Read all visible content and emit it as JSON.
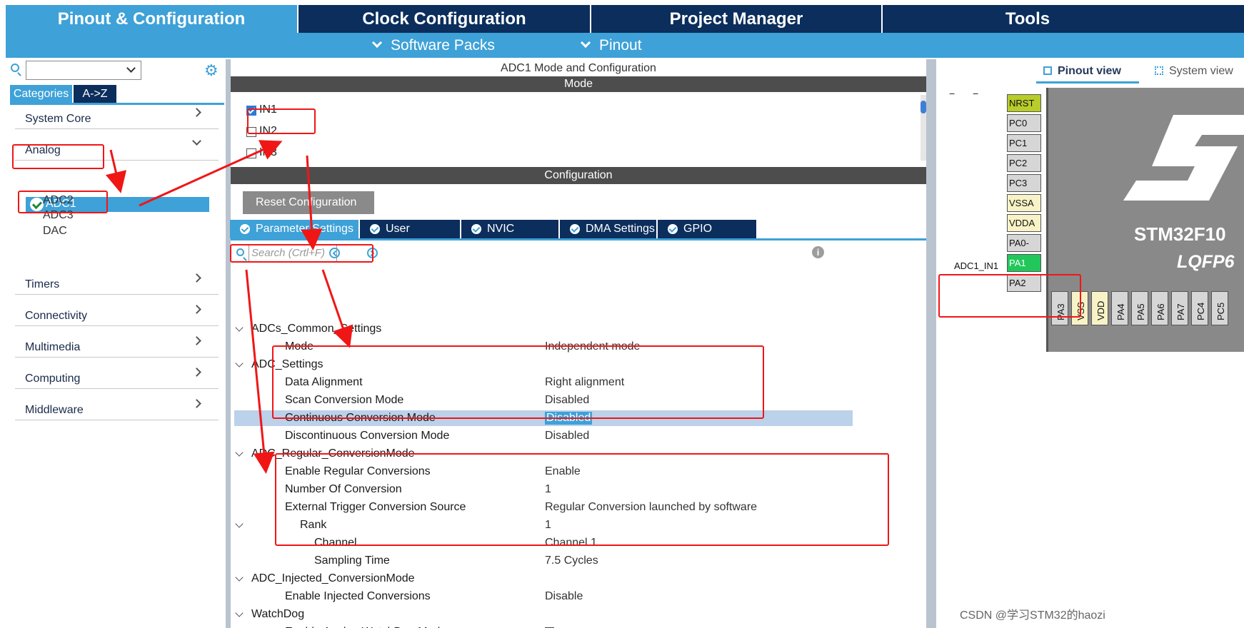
{
  "top_tabs": [
    "Pinout & Configuration",
    "Clock Configuration",
    "Project Manager",
    "Tools"
  ],
  "sub_menu": [
    "Software Packs",
    "Pinout"
  ],
  "left": {
    "category_tabs": [
      "Categories",
      "A->Z"
    ],
    "categories": [
      "System Core",
      "Analog",
      "Timers",
      "Connectivity",
      "Multimedia",
      "Computing",
      "Middleware"
    ],
    "analog_items": [
      "ADC1",
      "ADC2",
      "ADC3",
      "DAC"
    ]
  },
  "center": {
    "title": "ADC1 Mode and Configuration",
    "mode_header": "Mode",
    "mode_items": [
      {
        "label": "IN1",
        "checked": true
      },
      {
        "label": "IN2",
        "checked": false
      },
      {
        "label": "IN3",
        "checked": false
      }
    ],
    "config_header": "Configuration",
    "reset_button": "Reset Configuration",
    "tabs": [
      "Parameter Settings",
      "User Constants",
      "NVIC Settings",
      "DMA Settings",
      "GPIO Settings"
    ],
    "search_placeholder": "Search (Crtl+F)",
    "parameters": [
      {
        "name": "ADCs_Common_Settings",
        "value": "",
        "level": 0,
        "group": true
      },
      {
        "name": "Mode",
        "value": "Independent mode",
        "level": 1
      },
      {
        "name": "ADC_Settings",
        "value": "",
        "level": 0,
        "group": true
      },
      {
        "name": "Data Alignment",
        "value": "Right alignment",
        "level": 1
      },
      {
        "name": "Scan Conversion Mode",
        "value": "Disabled",
        "level": 1
      },
      {
        "name": "Continuous Conversion Mode",
        "value": "Disabled",
        "level": 1,
        "selected": true
      },
      {
        "name": "Discontinuous Conversion Mode",
        "value": "Disabled",
        "level": 1
      },
      {
        "name": "ADC_Regular_ConversionMode",
        "value": "",
        "level": 0,
        "group": true
      },
      {
        "name": "Enable Regular Conversions",
        "value": "Enable",
        "level": 1
      },
      {
        "name": "Number Of Conversion",
        "value": "1",
        "level": 1
      },
      {
        "name": "External Trigger Conversion Source",
        "value": "Regular Conversion launched by software",
        "level": 1
      },
      {
        "name": "Rank",
        "value": "1",
        "level": 2,
        "expander": true
      },
      {
        "name": "Channel",
        "value": "Channel 1",
        "level": 3
      },
      {
        "name": "Sampling Time",
        "value": "7.5 Cycles",
        "level": 3
      },
      {
        "name": "ADC_Injected_ConversionMode",
        "value": "",
        "level": 0,
        "group": true
      },
      {
        "name": "Enable Injected Conversions",
        "value": "Disable",
        "level": 1
      },
      {
        "name": "WatchDog",
        "value": "",
        "level": 0,
        "group": true
      },
      {
        "name": "Enable Analog WatchDog Mode",
        "value": "",
        "level": 1,
        "checkbox": true
      }
    ]
  },
  "right": {
    "view_tabs": [
      "Pinout view",
      "System view"
    ],
    "chip_name": "STM32F10",
    "package": "LQFP6",
    "left_pins": [
      "NRST",
      "PC0",
      "PC1",
      "PC2",
      "PC3",
      "VSSA",
      "VDDA",
      "PA0-",
      "PA1",
      "PA2"
    ],
    "bottom_pins": [
      "PA3",
      "VSS",
      "VDD",
      "PA4",
      "PA5",
      "PA6",
      "PA7",
      "PC4",
      "PC5"
    ],
    "pin_assignment": "ADC1_IN1"
  },
  "watermark": "CSDN @学习STM32的haozi"
}
